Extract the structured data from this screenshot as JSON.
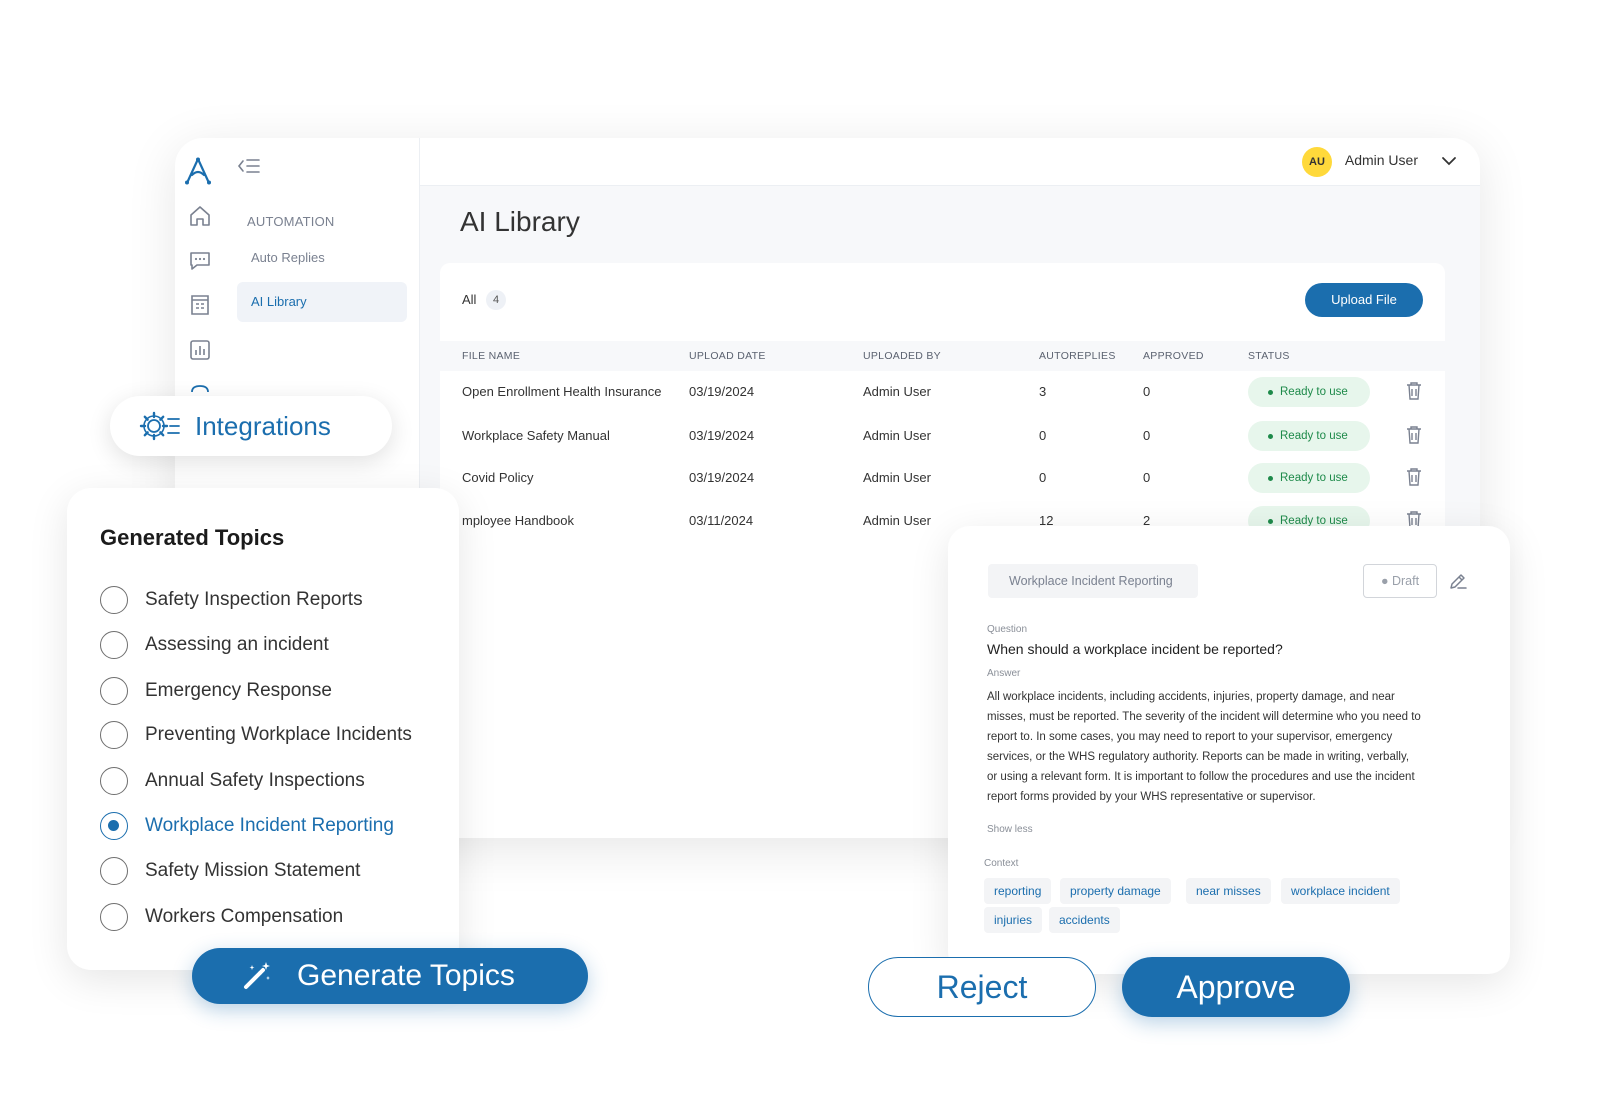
{
  "header": {
    "user_initials": "AU",
    "user_name": "Admin User"
  },
  "sidebar": {
    "section": "AUTOMATION",
    "items": [
      {
        "label": "Auto Replies"
      },
      {
        "label": "AI Library"
      }
    ]
  },
  "page": {
    "title": "AI Library"
  },
  "library": {
    "filter_label": "All",
    "filter_count": "4",
    "upload_label": "Upload File",
    "columns": [
      "FILE NAME",
      "UPLOAD DATE",
      "UPLOADED BY",
      "AUTOREPLIES",
      "APPROVED",
      "STATUS"
    ],
    "rows": [
      {
        "name": "Open Enrollment Health Insurance",
        "date": "03/19/2024",
        "by": "Admin User",
        "autoreplies": "3",
        "approved": "0",
        "status": "Ready to use"
      },
      {
        "name": "Workplace Safety Manual",
        "date": "03/19/2024",
        "by": "Admin User",
        "autoreplies": "0",
        "approved": "0",
        "status": "Ready to use"
      },
      {
        "name": "Covid Policy",
        "date": "03/19/2024",
        "by": "Admin User",
        "autoreplies": "0",
        "approved": "0",
        "status": "Ready to use"
      },
      {
        "name": "mployee Handbook",
        "date": "03/11/2024",
        "by": "Admin User",
        "autoreplies": "12",
        "approved": "2",
        "status": "Ready to use"
      }
    ]
  },
  "integrations": {
    "label": "Integrations"
  },
  "topics": {
    "title": "Generated Topics",
    "items": [
      {
        "label": "Safety Inspection Reports",
        "selected": false
      },
      {
        "label": "Assessing an incident",
        "selected": false
      },
      {
        "label": "Emergency Response",
        "selected": false
      },
      {
        "label": "Preventing Workplace Incidents",
        "selected": false
      },
      {
        "label": "Annual Safety Inspections",
        "selected": false
      },
      {
        "label": "Workplace Incident Reporting",
        "selected": true
      },
      {
        "label": "Safety Mission Statement",
        "selected": false
      },
      {
        "label": "Workers Compensation",
        "selected": false
      }
    ],
    "generate_label": "Generate Topics"
  },
  "qa": {
    "topic": "Workplace Incident Reporting",
    "draft_label": "Draft",
    "question_label": "Question",
    "question": "When should a workplace incident be reported?",
    "answer_label": "Answer",
    "answer": "All workplace incidents, including accidents, injuries, property damage, and near misses, must be reported. The severity of the incident will determine who you need to report to. In some cases, you may need to report to your supervisor, emergency services, or the WHS regulatory authority. Reports can be made in writing, verbally, or using a relevant form. It is important to follow the procedures and use the incident report forms provided by your WHS representative or supervisor.",
    "show_less": "Show less",
    "context_label": "Context",
    "context": [
      "reporting",
      "property damage",
      "near misses",
      "workplace incident",
      "injuries",
      "accidents"
    ]
  },
  "actions": {
    "reject": "Reject",
    "approve": "Approve"
  },
  "colors": {
    "accent": "#1b6eae",
    "ready_bg": "#e7f6ec",
    "ready_text": "#1e8a4a",
    "avatar": "#ffd93b"
  }
}
